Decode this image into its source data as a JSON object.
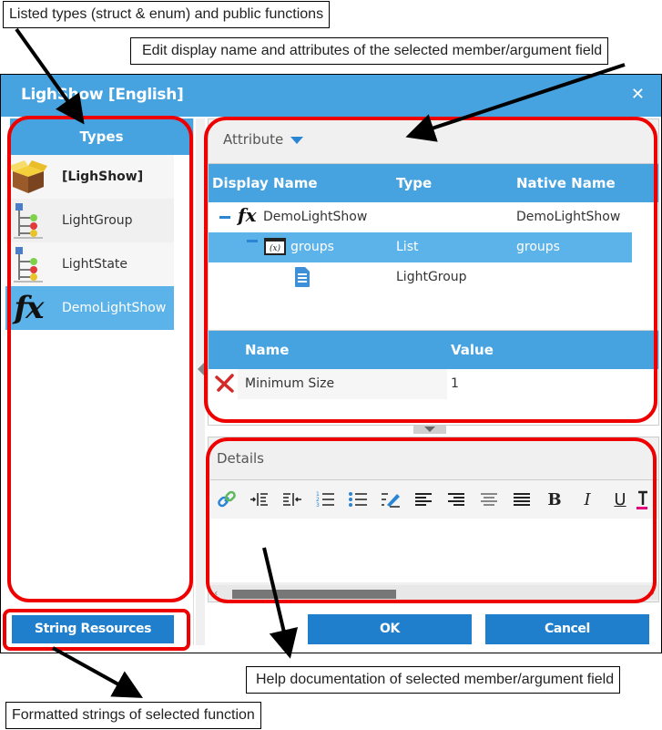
{
  "annotations": {
    "types_callout": "Listed types (struct & enum) and public functions",
    "attributes_callout": "Edit display name and attributes of the selected member/argument field",
    "details_callout": "Help documentation of selected member/argument field",
    "strings_callout": "Formatted strings of selected function"
  },
  "dialog": {
    "title": "LighShow [English]",
    "close_label": "✕"
  },
  "types_panel": {
    "header": "Types",
    "items": [
      {
        "label": "[LighShow]",
        "icon": "package-icon",
        "selected": false
      },
      {
        "label": "LightGroup",
        "icon": "struct-tree-icon",
        "selected": false
      },
      {
        "label": "LightState",
        "icon": "struct-tree-icon",
        "selected": false
      },
      {
        "label": "DemoLightShow",
        "icon": "function-fx-icon",
        "selected": true
      }
    ]
  },
  "attribute_panel": {
    "dropdown_label": "Attribute",
    "columns": [
      "Display Name",
      "Type",
      "Native Name"
    ],
    "rows": [
      {
        "display_name": "DemoLightShow",
        "type": "",
        "native_name": "DemoLightShow",
        "icon": "function-fx-icon",
        "level": 0,
        "expanded": true,
        "selected": false
      },
      {
        "display_name": "groups",
        "type": "List",
        "native_name": "groups",
        "icon": "variable-icon",
        "level": 1,
        "expanded": true,
        "selected": true
      },
      {
        "display_name": "",
        "type": "LightGroup",
        "native_name": "",
        "icon": "document-icon",
        "level": 2,
        "expanded": false,
        "selected": false
      }
    ],
    "property_columns": [
      "Name",
      "Value"
    ],
    "properties": [
      {
        "name": "Minimum Size",
        "value": "1"
      }
    ]
  },
  "details_panel": {
    "label": "Details",
    "toolbar": [
      "link",
      "indent",
      "outdent",
      "ordered-list",
      "unordered-list",
      "edit",
      "align-left",
      "align-right",
      "align-center",
      "justify",
      "bold",
      "italic",
      "underline",
      "text-color"
    ],
    "bold_glyph": "B",
    "italic_glyph": "I",
    "underline_glyph": "U",
    "content": ""
  },
  "footer": {
    "string_resources_label": "String Resources",
    "ok_label": "OK",
    "cancel_label": "Cancel"
  }
}
